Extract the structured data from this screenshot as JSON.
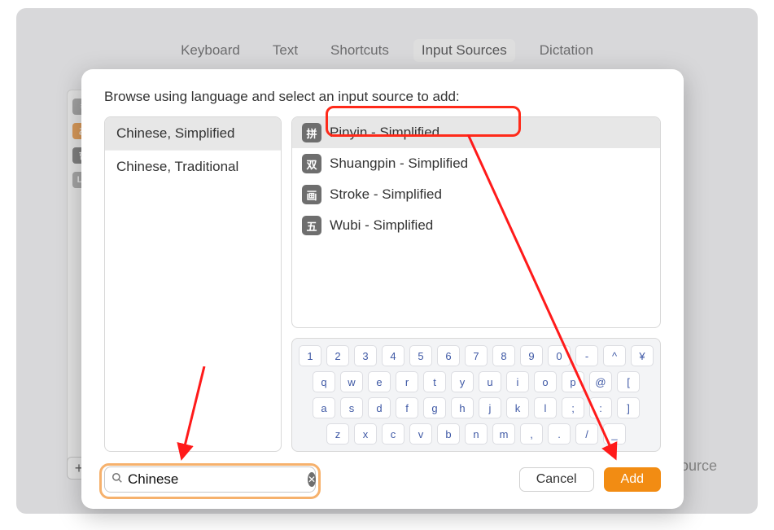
{
  "tabs": {
    "items": [
      {
        "label": "Keyboard"
      },
      {
        "label": "Text"
      },
      {
        "label": "Shortcuts"
      },
      {
        "label": "Input Sources",
        "active": true
      },
      {
        "label": "Dictation"
      }
    ]
  },
  "sidebar_icons": [
    "🇺🇸",
    "あ",
    "한",
    "LA"
  ],
  "backdrop": {
    "trailing_text": "ource"
  },
  "sheet": {
    "title": "Browse using language and select an input source to add:",
    "languages": [
      {
        "label": "Chinese, Simplified",
        "selected": true
      },
      {
        "label": "Chinese, Traditional",
        "selected": false
      }
    ],
    "sources": [
      {
        "icon": "拼",
        "label": "Pinyin - Simplified",
        "selected": true
      },
      {
        "icon": "双",
        "label": "Shuangpin - Simplified",
        "selected": false
      },
      {
        "icon": "画",
        "label": "Stroke - Simplified",
        "selected": false
      },
      {
        "icon": "五",
        "label": "Wubi - Simplified",
        "selected": false
      }
    ],
    "keyboard_rows": [
      [
        "1",
        "2",
        "3",
        "4",
        "5",
        "6",
        "7",
        "8",
        "9",
        "0",
        "-",
        "^",
        "¥"
      ],
      [
        "q",
        "w",
        "e",
        "r",
        "t",
        "y",
        "u",
        "i",
        "o",
        "p",
        "@",
        "["
      ],
      [
        "a",
        "s",
        "d",
        "f",
        "g",
        "h",
        "j",
        "k",
        "l",
        ";",
        ":",
        "]"
      ],
      [
        "z",
        "x",
        "c",
        "v",
        "b",
        "n",
        "m",
        ",",
        ".",
        "/",
        "_"
      ]
    ],
    "search": {
      "value": "Chinese"
    },
    "buttons": {
      "cancel": "Cancel",
      "add": "Add"
    }
  }
}
